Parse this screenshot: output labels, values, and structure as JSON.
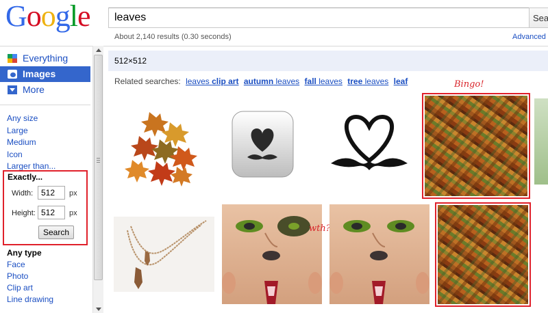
{
  "logo": {
    "letters": [
      "G",
      "o",
      "o",
      "g",
      "l",
      "e"
    ]
  },
  "search": {
    "query": "leaves",
    "button": "Search"
  },
  "stats": "About 2,140 results (0.30 seconds)",
  "advanced": "Advanced search",
  "nav": {
    "items": [
      {
        "label": "Everything",
        "icon": "everything-icon"
      },
      {
        "label": "Images",
        "icon": "camera-icon"
      },
      {
        "label": "More",
        "icon": "chevron-down-icon"
      }
    ]
  },
  "size_filters": [
    "Any size",
    "Large",
    "Medium",
    "Icon",
    "Larger than..."
  ],
  "exactly": {
    "header": "Exactly...",
    "width_label": "Width:",
    "width_value": "512",
    "width_unit": "px",
    "height_label": "Height:",
    "height_value": "512",
    "height_unit": "px",
    "search_button": "Search"
  },
  "type_filters": {
    "header": "Any type",
    "items": [
      "Face",
      "Photo",
      "Clip art",
      "Line drawing"
    ]
  },
  "size_bar": "512×512",
  "related": {
    "prefix": "Related searches:",
    "items": [
      {
        "plain": "leaves ",
        "bold": "clip art"
      },
      {
        "plain": "",
        "bold": "autumn",
        "plain_after": " leaves"
      },
      {
        "plain": "",
        "bold": "fall",
        "plain_after": " leaves"
      },
      {
        "plain": "",
        "bold": "tree",
        "plain_after": " leaves"
      },
      {
        "plain": "",
        "bold": "leaf"
      }
    ]
  },
  "annotations": {
    "bingo": "Bingo!",
    "wth": "wth?"
  },
  "colors": {
    "link": "#1a4ec2",
    "nav_active": "#3466cc",
    "annotation": "#e0202a",
    "size_bar": "#ebeff9"
  }
}
